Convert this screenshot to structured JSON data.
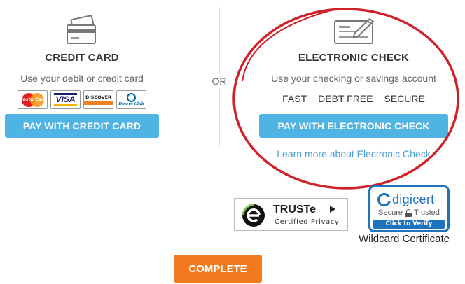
{
  "credit_card": {
    "title": "CREDIT CARD",
    "subtitle": "Use your debit or credit card",
    "card_logos": {
      "mastercard": "MasterCard",
      "visa": "VISA",
      "discover": "DISCOVER",
      "diners": "Diners Club"
    },
    "button_label": "PAY WITH CREDIT CARD",
    "icon": "credit-card-icon"
  },
  "or_label": "OR",
  "electronic_check": {
    "title": "ELECTRONIC CHECK",
    "subtitle": "Use your checking or savings account",
    "features": [
      "FAST",
      "DEBT FREE",
      "SECURE"
    ],
    "button_label": "PAY WITH ELECTRONIC CHECK",
    "learn_more": "Learn more about Electronic Check",
    "icon": "check-icon"
  },
  "badges": {
    "truste": {
      "name": "TRUSTe",
      "subtitle": "Certified Privacy"
    },
    "digicert": {
      "name": "digicert",
      "secure_text_1": "Secure",
      "secure_text_2": "Trusted",
      "verify_label": "Click to Verify",
      "caption": "Wildcard Certificate"
    }
  },
  "complete_button": "COMPLETE",
  "colors": {
    "primary_blue": "#4fb3e4",
    "link_blue": "#4a9fd4",
    "complete_orange": "#f47a20",
    "annotation_red": "#d0202a",
    "digicert_blue": "#1e73be"
  }
}
